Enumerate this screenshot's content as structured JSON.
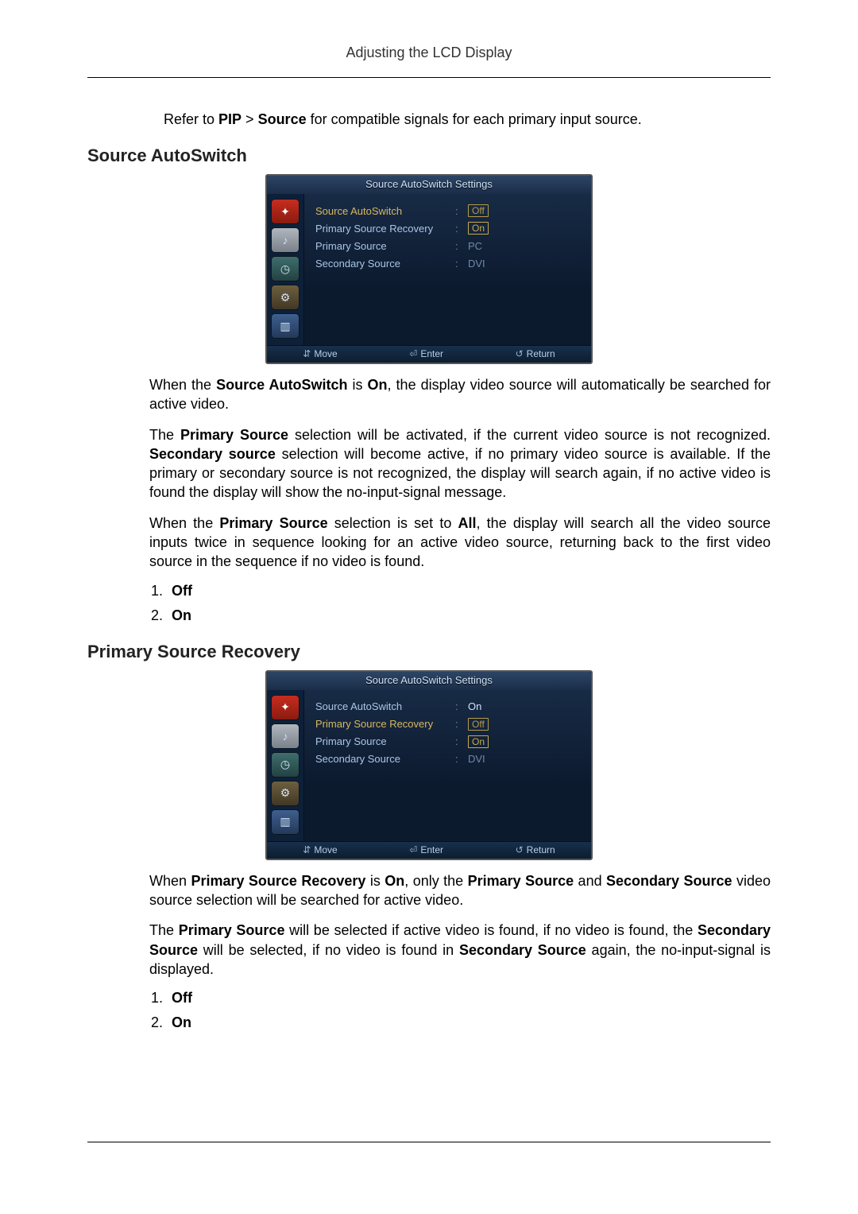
{
  "page_header": "Adjusting the LCD Display",
  "intro": {
    "prefix": "Refer to ",
    "pip": "PIP",
    "gt": " > ",
    "source": "Source",
    "suffix": " for compatible signals for each primary input source."
  },
  "section1": {
    "heading": "Source AutoSwitch",
    "osd": {
      "title": "Source AutoSwitch Settings",
      "rows": [
        {
          "label": "Source AutoSwitch",
          "value_left": "Off",
          "value_right": "",
          "selected": true,
          "boxed": "Off"
        },
        {
          "label": "Primary Source Recovery",
          "value_left": "",
          "value_right": "",
          "boxed": "On",
          "selected": false,
          "boxed_only": true
        },
        {
          "label": "Primary Source",
          "value_left": "PC",
          "value_right": "",
          "selected": false,
          "dim": true
        },
        {
          "label": "Secondary Source",
          "value_left": "DVI",
          "value_right": "",
          "selected": false,
          "dim": true
        }
      ],
      "foot": {
        "move": "Move",
        "enter": "Enter",
        "return": "Return"
      }
    },
    "para1_a": "When the ",
    "para1_b": "Source AutoSwitch",
    "para1_c": " is ",
    "para1_d": "On",
    "para1_e": ", the display video source will automatically be searched for active video.",
    "para2_a": "The ",
    "para2_b": "Primary Source",
    "para2_c": " selection will be activated, if the current video source is not recognized. ",
    "para2_d": "Secondary source",
    "para2_e": " selection will become active, if no primary video source is available. If the primary or secondary source is not recognized, the display will search again, if no active video is found the display will show the no-input-signal message.",
    "para3_a": "When the ",
    "para3_b": "Primary Source",
    "para3_c": " selection is set to ",
    "para3_d": "All",
    "para3_e": ", the display will search all the video source inputs twice in sequence looking for an active video source, returning back to the first video source in the sequence if no video is found.",
    "list": {
      "i1": "Off",
      "i2": "On"
    }
  },
  "section2": {
    "heading": "Primary Source Recovery",
    "osd": {
      "title": "Source AutoSwitch Settings",
      "rows": [
        {
          "label": "Source AutoSwitch",
          "value_left": "On",
          "selected": false
        },
        {
          "label": "Primary Source Recovery",
          "boxed": "Off",
          "selected": true,
          "boxed_only": true
        },
        {
          "label": "Primary Source",
          "boxed": "On",
          "selected": false,
          "boxed_only": true,
          "dim": true
        },
        {
          "label": "Secondary Source",
          "value_left": "DVI",
          "selected": false,
          "dim": true
        }
      ],
      "foot": {
        "move": "Move",
        "enter": "Enter",
        "return": "Return"
      }
    },
    "para1_a": "When ",
    "para1_b": "Primary Source Recovery",
    "para1_c": " is ",
    "para1_d": "On",
    "para1_e": ", only the ",
    "para1_f": "Primary Source",
    "para1_g": " and ",
    "para1_h": "Secondary Source",
    "para1_i": " video source selection will be searched for active video.",
    "para2_a": "The ",
    "para2_b": "Primary Source",
    "para2_c": " will be selected if active video is found, if no video is found, the ",
    "para2_d": "Secondary Source",
    "para2_e": " will be selected, if no video is found in ",
    "para2_f": "Secondary Source",
    "para2_g": " again, the no-input-signal is displayed.",
    "list": {
      "i1": "Off",
      "i2": "On"
    }
  },
  "icons": {
    "i1": "picture-icon",
    "i2": "sound-icon",
    "i3": "clock-icon",
    "i4": "settings-icon",
    "i5": "multi-icon"
  },
  "glyphs": {
    "move": "⇵",
    "enter": "⏎",
    "return": "↺"
  }
}
